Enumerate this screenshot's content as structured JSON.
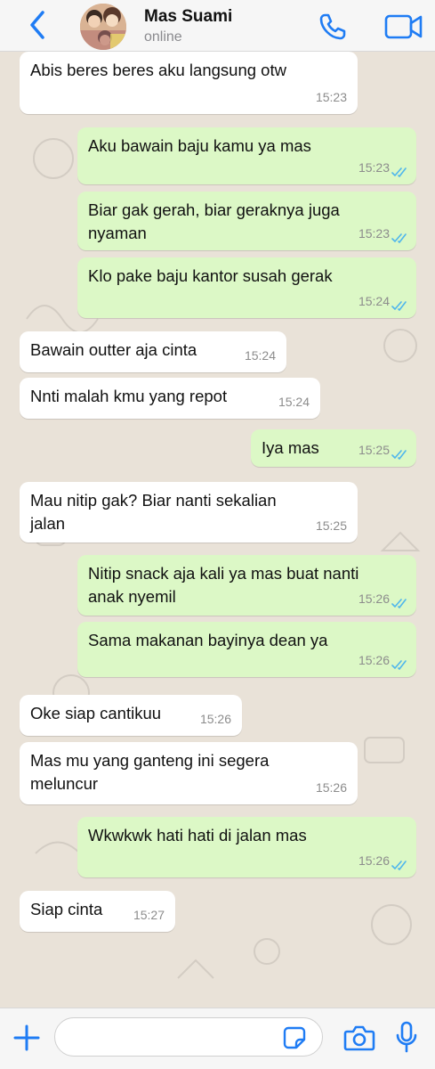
{
  "header": {
    "contact_name": "Mas Suami",
    "status": "online",
    "icons": {
      "back": "chevron-left-icon",
      "call": "phone-icon",
      "video": "video-camera-icon"
    },
    "accent_color": "#1f7cf4"
  },
  "messages": [
    {
      "dir": "in",
      "text": "Abis beres beres aku langsung otw",
      "time": "15:23"
    },
    {
      "dir": "out",
      "text": "Aku bawain baju kamu ya mas",
      "time": "15:23"
    },
    {
      "dir": "out",
      "text": "Biar gak gerah, biar geraknya juga\nnyaman",
      "time": "15:23"
    },
    {
      "dir": "out",
      "text": "Klo pake baju kantor susah gerak",
      "time": "15:24"
    },
    {
      "dir": "in",
      "text": "Bawain outter aja cinta",
      "time": "15:24"
    },
    {
      "dir": "in",
      "text": "Nnti malah kmu yang repot",
      "time": "15:24"
    },
    {
      "dir": "out",
      "text": "Iya mas",
      "time": "15:25"
    },
    {
      "dir": "in",
      "text": "Mau nitip gak? Biar nanti sekalian\njalan",
      "time": "15:25"
    },
    {
      "dir": "out",
      "text": "Nitip snack aja kali ya mas buat nanti\nanak nyemil",
      "time": "15:26"
    },
    {
      "dir": "out",
      "text": "Sama makanan bayinya dean ya",
      "time": "15:26"
    },
    {
      "dir": "in",
      "text": "Oke siap cantikuu",
      "time": "15:26"
    },
    {
      "dir": "in",
      "text": "Mas mu yang ganteng ini segera\nmeluncur",
      "time": "15:26"
    },
    {
      "dir": "out",
      "text": "Wkwkwk hati hati di jalan mas",
      "time": "15:26"
    },
    {
      "dir": "in",
      "text": "Siap cinta",
      "time": "15:27"
    }
  ],
  "colors": {
    "incoming_bubble": "#ffffff",
    "outgoing_bubble": "#dcf8c6",
    "read_ticks": "#4fb6ec",
    "wallpaper": "#e9e2d8"
  },
  "input_bar": {
    "placeholder": "",
    "icons": {
      "plus": "plus-icon",
      "sticker": "sticker-icon",
      "camera": "camera-icon",
      "mic": "microphone-icon"
    }
  }
}
